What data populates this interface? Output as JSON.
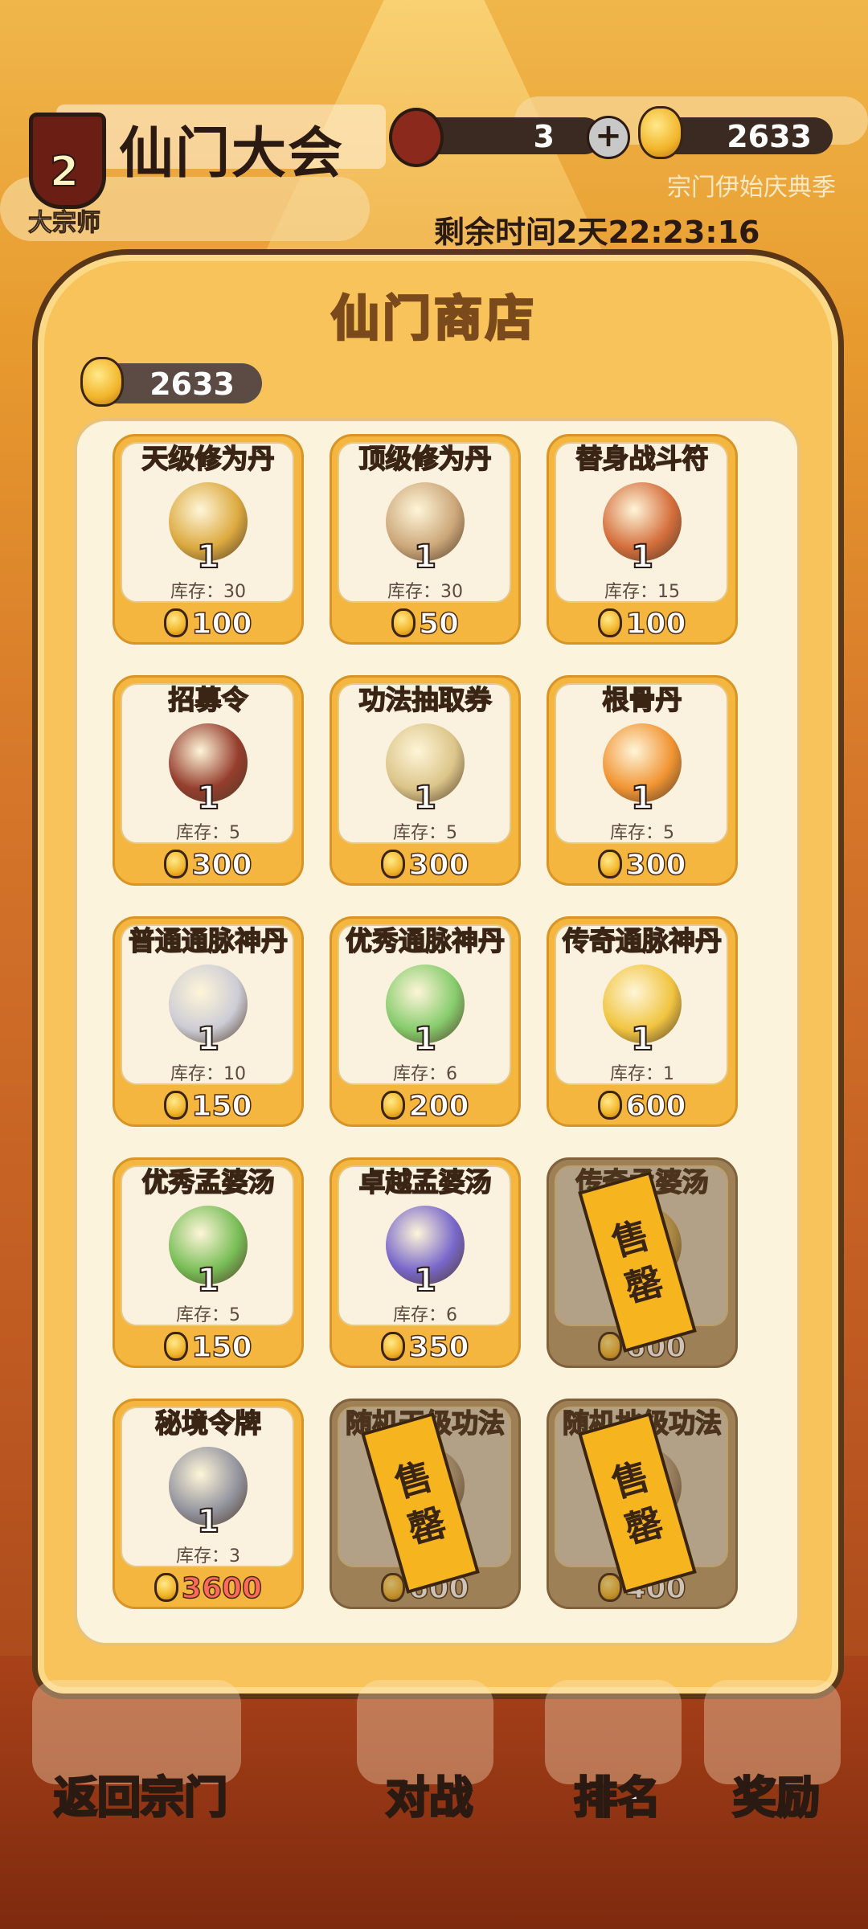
{
  "header": {
    "rank_number": "2",
    "rank_title": "大宗师",
    "event_title": "仙门大会",
    "ticket_count": "3",
    "currency_amount": "2633",
    "season_name": "宗门伊始庆典季",
    "timer": "剩余时间2天22:23:16"
  },
  "shop": {
    "title": "仙门商店",
    "currency_amount": "2633",
    "items": [
      {
        "name": "天级修为丹",
        "qty": "1",
        "stock": "库存：30",
        "price": "100",
        "sold_out": false,
        "icon": "pill-box-icon"
      },
      {
        "name": "顶级修为丹",
        "qty": "1",
        "stock": "库存：30",
        "price": "50",
        "sold_out": false,
        "icon": "gourd-pills-icon"
      },
      {
        "name": "替身战斗符",
        "qty": "1",
        "stock": "库存：15",
        "price": "100",
        "sold_out": false,
        "icon": "talisman-icon"
      },
      {
        "name": "招募令",
        "qty": "1",
        "stock": "库存：5",
        "price": "300",
        "sold_out": false,
        "icon": "recruit-token-icon"
      },
      {
        "name": "功法抽取券",
        "qty": "1",
        "stock": "库存：5",
        "price": "300",
        "sold_out": false,
        "icon": "scroll-icon"
      },
      {
        "name": "根骨丹",
        "qty": "1",
        "stock": "库存：5",
        "price": "300",
        "sold_out": false,
        "icon": "orange-orb-icon"
      },
      {
        "name": "普通通脉神丹",
        "qty": "1",
        "stock": "库存：10",
        "price": "150",
        "sold_out": false,
        "icon": "white-orb-icon"
      },
      {
        "name": "优秀通脉神丹",
        "qty": "1",
        "stock": "库存：6",
        "price": "200",
        "sold_out": false,
        "icon": "green-orb-icon"
      },
      {
        "name": "传奇通脉神丹",
        "qty": "1",
        "stock": "库存：1",
        "price": "600",
        "sold_out": false,
        "icon": "gold-orb-icon"
      },
      {
        "name": "优秀孟婆汤",
        "qty": "1",
        "stock": "库存：5",
        "price": "150",
        "sold_out": false,
        "icon": "green-soup-icon"
      },
      {
        "name": "卓越孟婆汤",
        "qty": "1",
        "stock": "库存：6",
        "price": "350",
        "sold_out": false,
        "icon": "purple-soup-icon"
      },
      {
        "name": "传奇孟婆汤",
        "qty": "",
        "stock": "库",
        "price": "600",
        "sold_out": true,
        "icon": "gold-soup-icon"
      },
      {
        "name": "秘境令牌",
        "qty": "1",
        "stock": "库存：3",
        "price": "3600",
        "sold_out": false,
        "price_red": true,
        "icon": "ring-token-icon"
      },
      {
        "name": "随机天级功法",
        "qty": "",
        "stock": "库",
        "price": "600",
        "sold_out": true,
        "icon": "book-icon"
      },
      {
        "name": "随机地级功法",
        "qty": "",
        "stock": "库",
        "price": "400",
        "sold_out": true,
        "icon": "book-icon"
      }
    ],
    "sold_out_char1": "售",
    "sold_out_char2": "罄"
  },
  "nav": {
    "back": "返回宗门",
    "battle": "对战",
    "ranking": "排名",
    "rewards": "奖励"
  },
  "colors": {
    "panel": "#f7c35a",
    "card": "#f4b63e",
    "soldout_tag": "#f6b41e",
    "price_red": "#ff6a5a"
  }
}
